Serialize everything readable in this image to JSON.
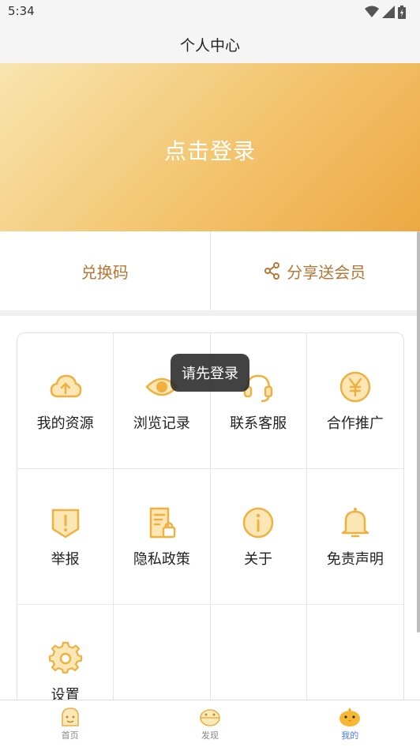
{
  "status_bar": {
    "time": "5:34"
  },
  "header": {
    "title": "个人中心"
  },
  "banner": {
    "login_label": "点击登录"
  },
  "actions": {
    "redeem_label": "兑换码",
    "share_label": "分享送会员"
  },
  "grid": {
    "items": [
      {
        "label": "我的资源",
        "icon": "cloud-upload-icon"
      },
      {
        "label": "浏览记录",
        "icon": "eye-icon"
      },
      {
        "label": "联系客服",
        "icon": "headset-icon"
      },
      {
        "label": "合作推广",
        "icon": "yen-coin-icon"
      },
      {
        "label": "举报",
        "icon": "report-shield-icon"
      },
      {
        "label": "隐私政策",
        "icon": "privacy-document-icon"
      },
      {
        "label": "关于",
        "icon": "info-icon"
      },
      {
        "label": "免责声明",
        "icon": "bell-icon"
      },
      {
        "label": "设置",
        "icon": "gear-icon"
      }
    ]
  },
  "toast": {
    "message": "请先登录"
  },
  "bottom_nav": {
    "items": [
      {
        "label": "首页",
        "icon": "home-face-icon"
      },
      {
        "label": "发现",
        "icon": "discover-face-icon"
      },
      {
        "label": "我的",
        "icon": "mine-chick-icon",
        "active": true
      }
    ]
  },
  "colors": {
    "accent": "#f0b040",
    "brown_text": "#b57634",
    "active_nav": "#4a7cf0"
  }
}
